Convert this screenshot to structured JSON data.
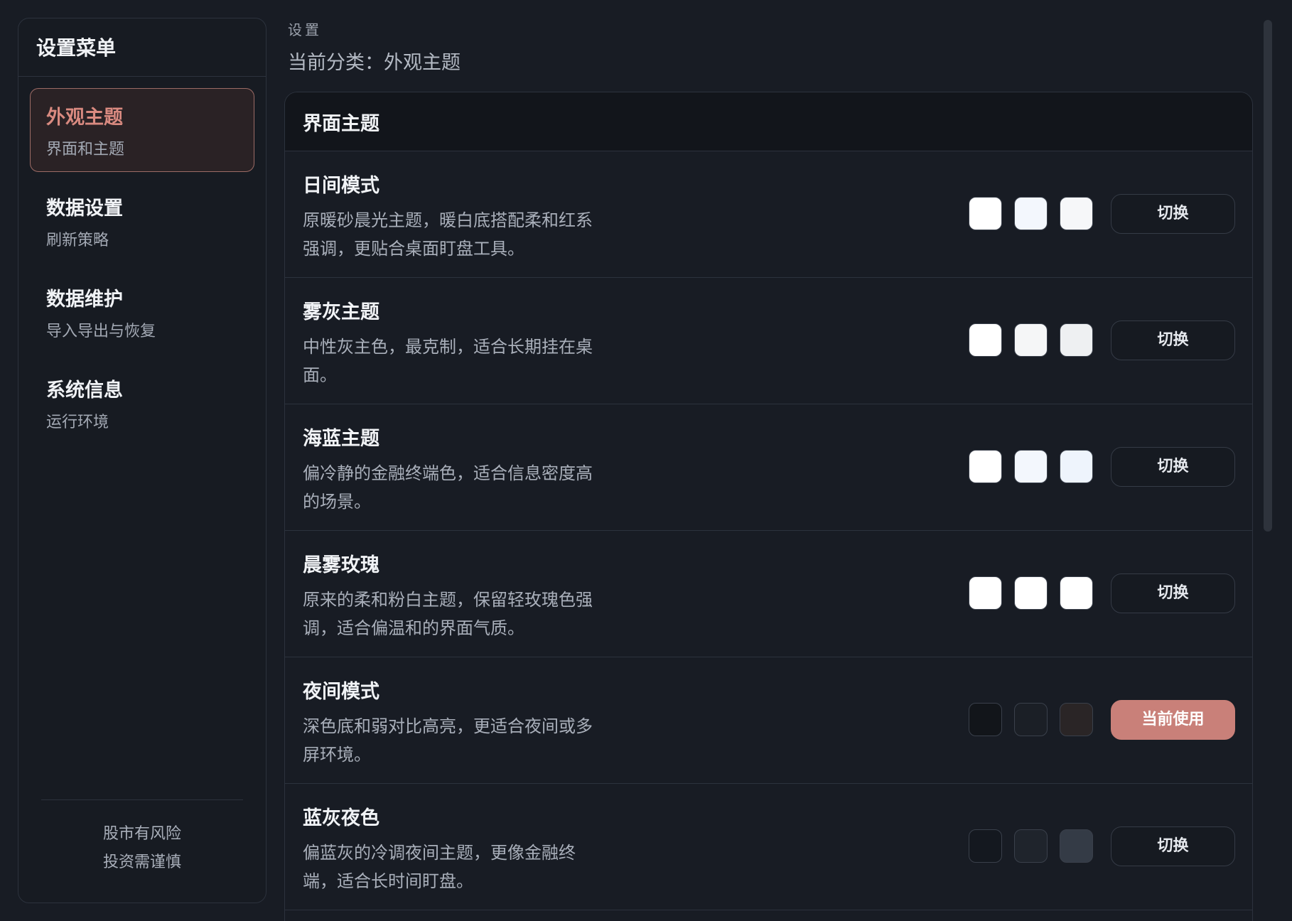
{
  "sidebar": {
    "title": "设置菜单",
    "items": [
      {
        "title": "外观主题",
        "subtitle": "界面和主题",
        "active": true
      },
      {
        "title": "数据设置",
        "subtitle": "刷新策略",
        "active": false
      },
      {
        "title": "数据维护",
        "subtitle": "导入导出与恢复",
        "active": false
      },
      {
        "title": "系统信息",
        "subtitle": "运行环境",
        "active": false
      }
    ],
    "footer": {
      "line1": "股市有风险",
      "line2": "投资需谨慎"
    }
  },
  "main": {
    "breadcrumb": "设置",
    "current_category": "当前分类：外观主题",
    "card_title": "界面主题",
    "themes": [
      {
        "name": "日间模式",
        "description": "原暖砂晨光主题，暖白底搭配柔和红系强调，更贴合桌面盯盘工具。",
        "swatches": [
          "#ffffff",
          "#f3f7fd",
          "#f6f7f9"
        ],
        "button_label": "切换",
        "current": false
      },
      {
        "name": "雾灰主题",
        "description": "中性灰主色，最克制，适合长期挂在桌面。",
        "swatches": [
          "#ffffff",
          "#f5f6f7",
          "#eef0f2"
        ],
        "button_label": "切换",
        "current": false
      },
      {
        "name": "海蓝主题",
        "description": "偏冷静的金融终端色，适合信息密度高的场景。",
        "swatches": [
          "#ffffff",
          "#f3f7fd",
          "#eef4fc"
        ],
        "button_label": "切换",
        "current": false
      },
      {
        "name": "晨雾玫瑰",
        "description": "原来的柔和粉白主题，保留轻玫瑰色强调，适合偏温和的界面气质。",
        "swatches": [
          "#ffffff",
          "#ffffff",
          "#ffffff"
        ],
        "button_label": "切换",
        "current": false
      },
      {
        "name": "夜间模式",
        "description": "深色底和弱对比高亮，更适合夜间或多屏环境。",
        "swatches": [
          "#12151a",
          "#1b1f26",
          "#2a2526"
        ],
        "button_label": "当前使用",
        "current": true
      },
      {
        "name": "蓝灰夜色",
        "description": "偏蓝灰的冷调夜间主题，更像金融终端，适合长时间盯盘。",
        "swatches": [
          "#14181f",
          "#1f242c",
          "#343b46"
        ],
        "button_label": "切换",
        "current": false
      }
    ]
  },
  "colors": {
    "accent": "#c98079",
    "active_title": "#d98a80",
    "background": "#181c24"
  }
}
